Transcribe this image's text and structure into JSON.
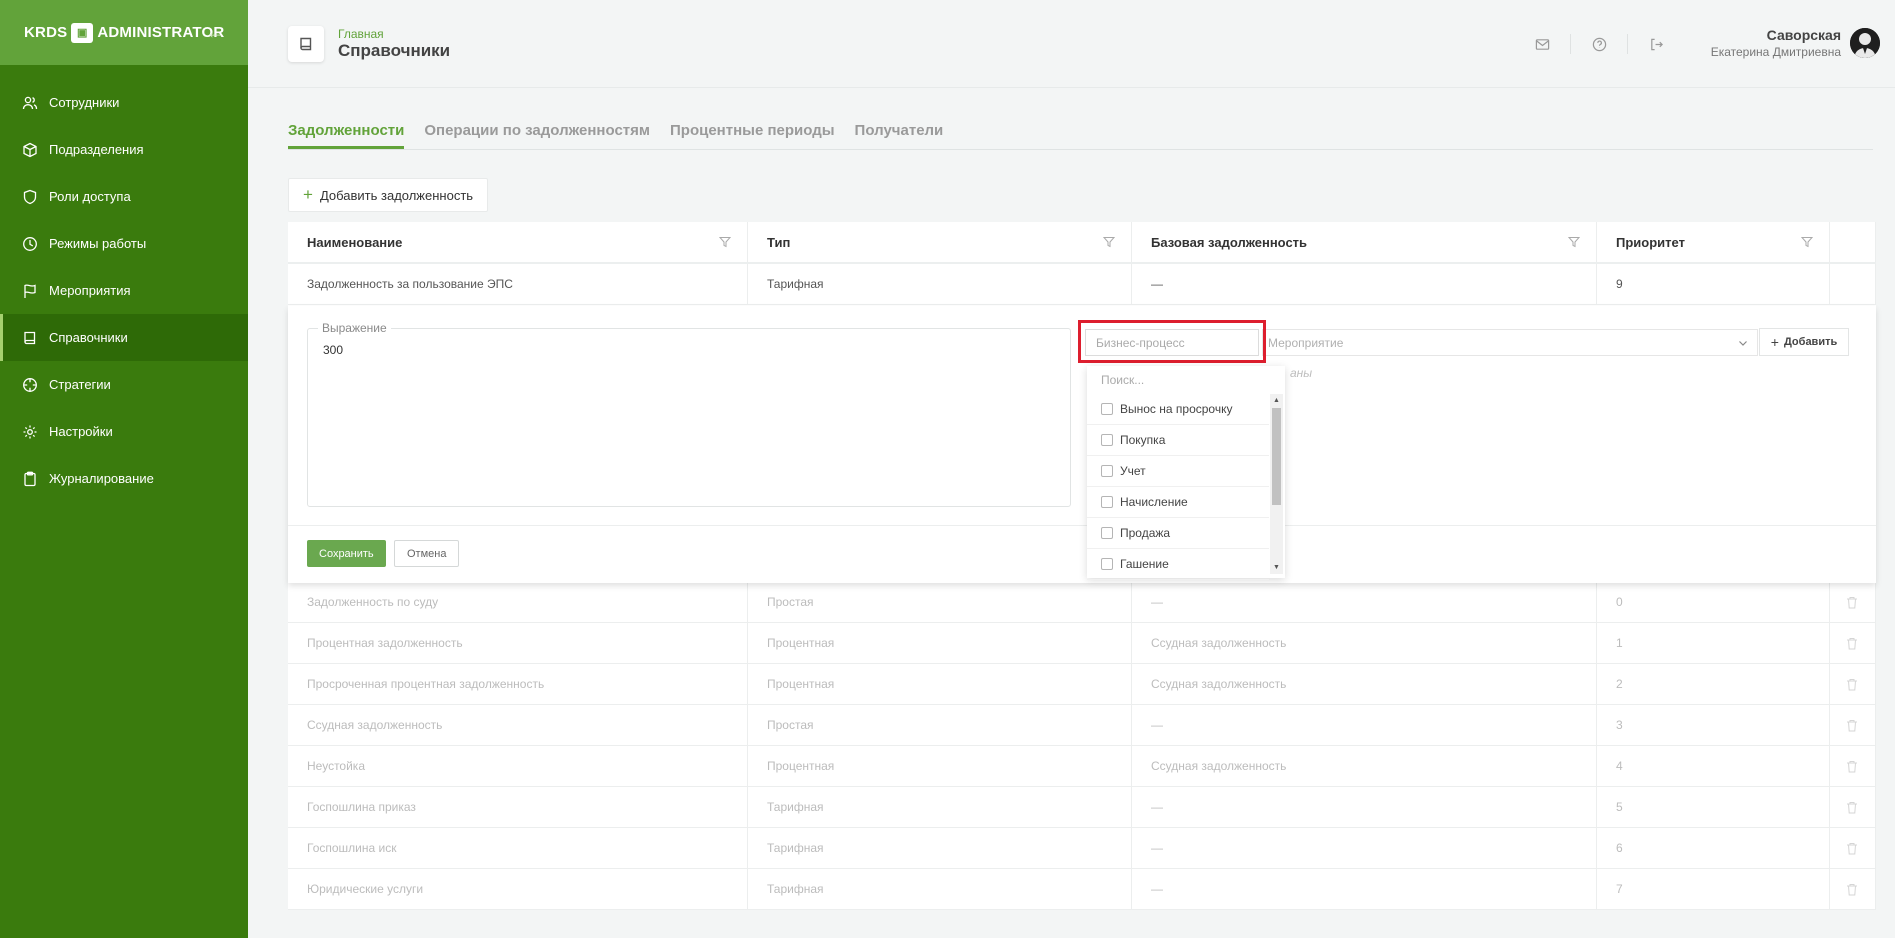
{
  "app": {
    "logo_left": "KRDS",
    "logo_right": "ADMINISTRATOR"
  },
  "sidebar": {
    "items": [
      {
        "label": "Сотрудники",
        "icon": "users-icon"
      },
      {
        "label": "Подразделения",
        "icon": "cube-icon"
      },
      {
        "label": "Роли доступа",
        "icon": "shield-icon"
      },
      {
        "label": "Режимы работы",
        "icon": "clock-icon"
      },
      {
        "label": "Мероприятия",
        "icon": "flag-icon"
      },
      {
        "label": "Справочники",
        "icon": "book-icon",
        "active": true
      },
      {
        "label": "Стратегии",
        "icon": "crosshair-icon"
      },
      {
        "label": "Настройки",
        "icon": "gear-icon"
      },
      {
        "label": "Журналирование",
        "icon": "clipboard-icon"
      }
    ]
  },
  "header": {
    "breadcrumb": "Главная",
    "title": "Справочники",
    "user_surname": "Саворская",
    "user_name": "Екатерина Дмитриевна"
  },
  "tabs": [
    {
      "label": "Задолженности",
      "active": true
    },
    {
      "label": "Операции по задолженностям"
    },
    {
      "label": "Процентные периоды"
    },
    {
      "label": "Получатели"
    }
  ],
  "add_button_label": "Добавить задолженность",
  "table": {
    "columns": [
      "Наименование",
      "Тип",
      "Базовая задолженность",
      "Приоритет"
    ],
    "edited_row": {
      "name": "Задолженность за пользование ЭПС",
      "type": "Тарифная",
      "base": "—",
      "priority": "9"
    },
    "rows": [
      {
        "name": "Задолженность по суду",
        "type": "Простая",
        "base": "—",
        "priority": "0"
      },
      {
        "name": "Процентная задолженность",
        "type": "Процентная",
        "base": "Ссудная задолженность",
        "priority": "1"
      },
      {
        "name": "Просроченная процентная задолженность",
        "type": "Процентная",
        "base": "Ссудная задолженность",
        "priority": "2"
      },
      {
        "name": "Ссудная задолженность",
        "type": "Простая",
        "base": "—",
        "priority": "3"
      },
      {
        "name": "Неустойка",
        "type": "Процентная",
        "base": "Ссудная задолженность",
        "priority": "4"
      },
      {
        "name": "Госпошлина приказ",
        "type": "Тарифная",
        "base": "—",
        "priority": "5"
      },
      {
        "name": "Госпошлина иск",
        "type": "Тарифная",
        "base": "—",
        "priority": "6"
      },
      {
        "name": "Юридические услуги",
        "type": "Тарифная",
        "base": "—",
        "priority": "7"
      }
    ]
  },
  "edit_panel": {
    "expression_label": "Выражение",
    "expression_value": "300",
    "business_process_placeholder": "Бизнес-процесс",
    "event_placeholder": "Мероприятие",
    "add_label": "Добавить",
    "hint_fragment": "аны",
    "save_label": "Сохранить",
    "cancel_label": "Отмена"
  },
  "dropdown": {
    "search_placeholder": "Поиск...",
    "options": [
      "Вынос на просрочку",
      "Покупка",
      "Учет",
      "Начисление",
      "Продажа",
      "Гашение"
    ]
  },
  "colors": {
    "sidebar": "#3a7b0d",
    "sidebar_header": "#62a33a",
    "accent": "#62a33a",
    "highlight": "#dd1e2e"
  }
}
